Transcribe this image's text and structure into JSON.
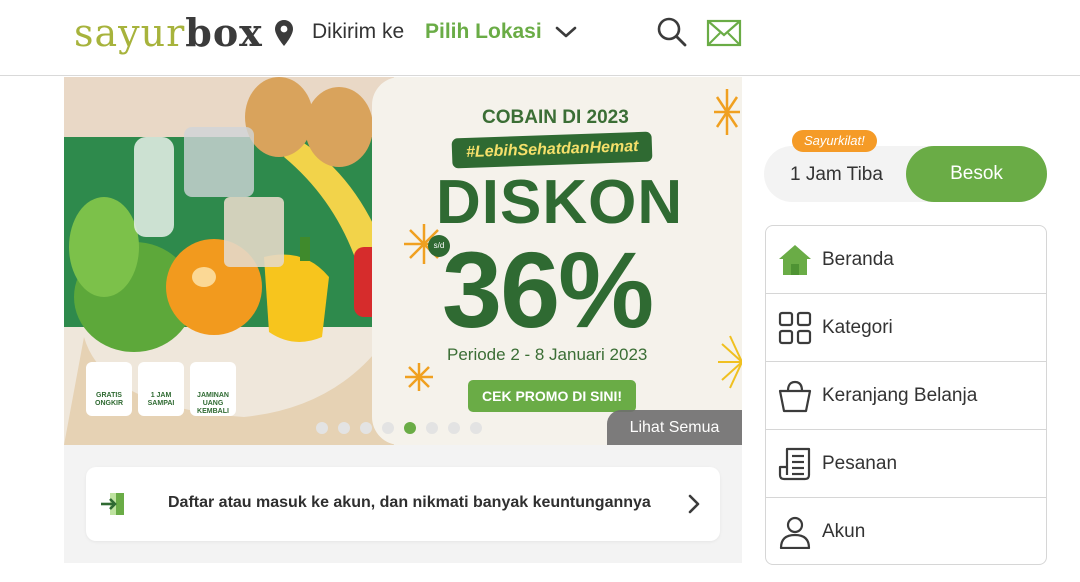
{
  "header": {
    "logo_part1": "sayur",
    "logo_part2": "box",
    "location_prefix": "Dikirim ke",
    "location_value": "Pilih Lokasi"
  },
  "banner": {
    "top_text": "COBAIN DI 2023",
    "hashtag": "#LebihSehatdanHemat",
    "headline": "DISKON",
    "upto": "s/d",
    "percent": "36%",
    "period": "Periode 2 - 8 Januari 2023",
    "cta": "CEK PROMO DI SINI!",
    "see_all": "Lihat Semua",
    "badges": [
      "GRATIS ONGKIR",
      "1 JAM SAMPAI",
      "JAMINAN UANG KEMBALI"
    ],
    "carousel_total": 8,
    "carousel_active_index": 4
  },
  "login_prompt": {
    "text": "Daftar atau masuk ke akun, dan nikmati banyak keuntungannya"
  },
  "delivery": {
    "badge": "Sayurkilat!",
    "option_1": "1 Jam Tiba",
    "option_2": "Besok",
    "selected": "Besok"
  },
  "menu": {
    "items": [
      {
        "label": "Beranda",
        "icon": "home-icon"
      },
      {
        "label": "Kategori",
        "icon": "grid-icon"
      },
      {
        "label": "Keranjang Belanja",
        "icon": "basket-icon"
      },
      {
        "label": "Pesanan",
        "icon": "receipt-icon"
      },
      {
        "label": "Akun",
        "icon": "user-icon"
      }
    ]
  },
  "colors": {
    "brand_green": "#6aac46",
    "dark_green": "#2f6a32",
    "logo_olive": "#a7b33c",
    "badge_orange": "#f59b27"
  }
}
